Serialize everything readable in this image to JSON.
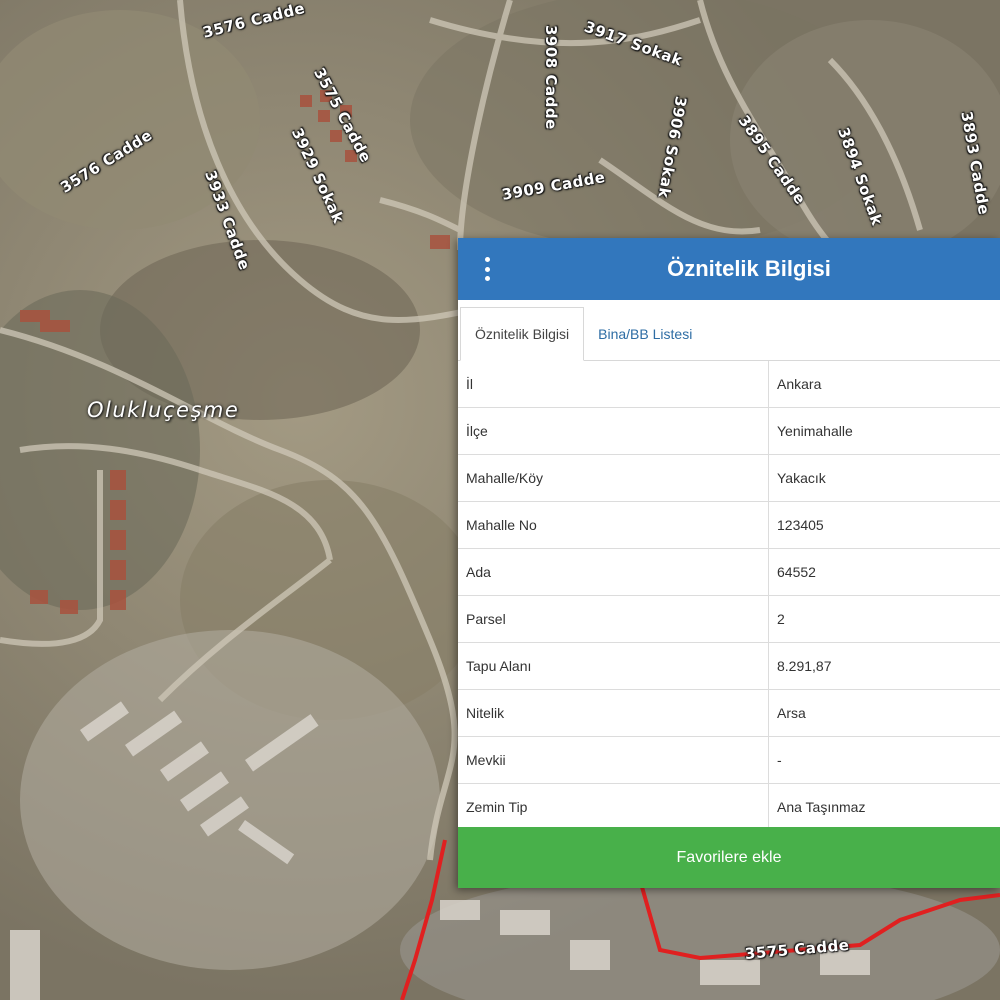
{
  "map": {
    "place_label": "Olukluçeşme",
    "streets": [
      {
        "id": "3576-cadde-top",
        "text": "3576 Cadde"
      },
      {
        "id": "3575-cadde",
        "text": "3575 Cadde"
      },
      {
        "id": "3929-sokak",
        "text": "3929 Sokak"
      },
      {
        "id": "3908-cadde",
        "text": "3908 Cadde"
      },
      {
        "id": "3917-sokak",
        "text": "3917 Sokak"
      },
      {
        "id": "3576-cadde-left",
        "text": "3576 Cadde"
      },
      {
        "id": "3933-cadde",
        "text": "3933 Cadde"
      },
      {
        "id": "3909-cadde",
        "text": "3909 Cadde"
      },
      {
        "id": "3906-sokak",
        "text": "3906 Sokak"
      },
      {
        "id": "3895-cadde",
        "text": "3895 Cadde"
      },
      {
        "id": "3894-sokak",
        "text": "3894 Sokak"
      },
      {
        "id": "3893-cadde",
        "text": "3893 Cadde"
      },
      {
        "id": "3575-cadde-bottom",
        "text": "3575 Cadde"
      }
    ],
    "colors": {
      "parcel_border": "#e02020",
      "ground": "#8c8472",
      "roads": "#c9c2b2"
    }
  },
  "panel": {
    "title": "Öznitelik Bilgisi",
    "menu_icon": "vertical-dots-icon",
    "tabs": [
      {
        "label": "Öznitelik Bilgisi",
        "active": true
      },
      {
        "label": "Bina/BB Listesi",
        "active": false
      }
    ],
    "rows": [
      {
        "key": "İl",
        "value": "Ankara"
      },
      {
        "key": "İlçe",
        "value": "Yenimahalle"
      },
      {
        "key": "Mahalle/Köy",
        "value": "Yakacık"
      },
      {
        "key": "Mahalle No",
        "value": "123405"
      },
      {
        "key": "Ada",
        "value": "64552"
      },
      {
        "key": "Parsel",
        "value": "2"
      },
      {
        "key": "Tapu Alanı",
        "value": "8.291,87"
      },
      {
        "key": "Nitelik",
        "value": "Arsa"
      },
      {
        "key": "Mevkii",
        "value": "-"
      },
      {
        "key": "Zemin Tip",
        "value": "Ana Taşınmaz"
      }
    ],
    "favorite_button": "Favorilere ekle",
    "colors": {
      "header": "#3277bd",
      "button": "#48b04a"
    }
  }
}
